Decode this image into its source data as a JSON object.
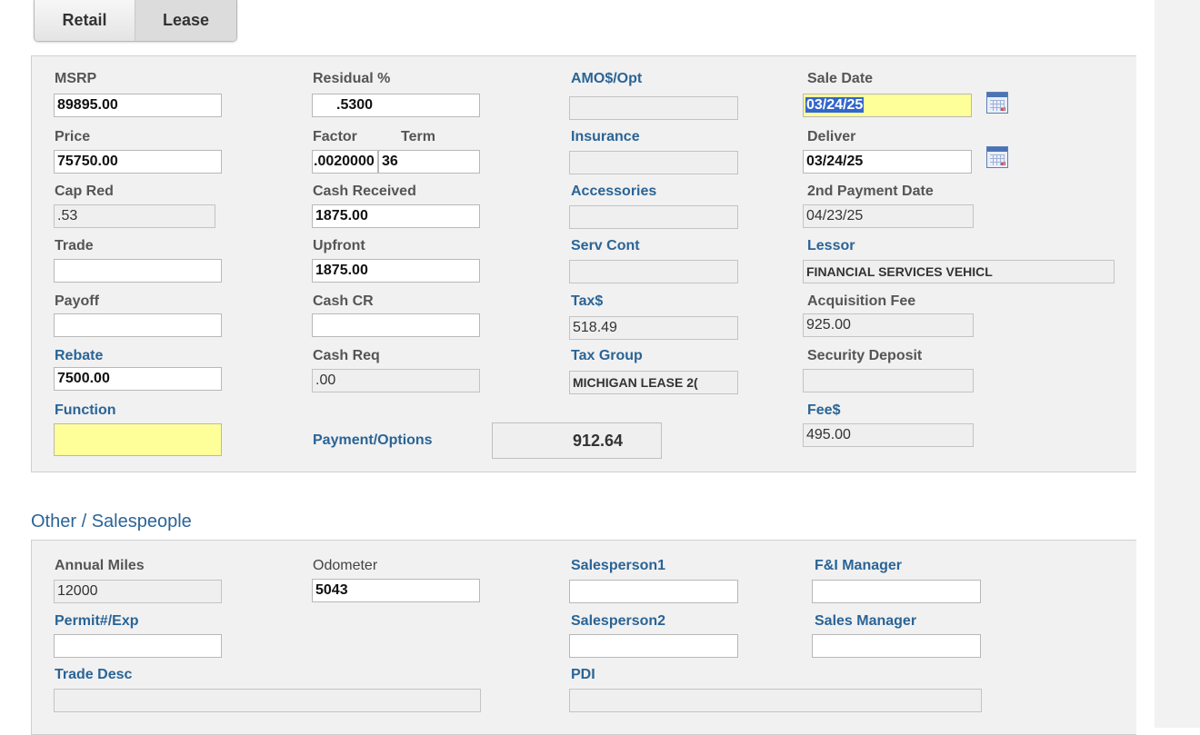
{
  "tabs": {
    "retail": "Retail",
    "lease": "Lease"
  },
  "col1": {
    "msrp_label": "MSRP",
    "msrp": "89895.00",
    "price_label": "Price",
    "price": "75750.00",
    "cap_red_label": "Cap Red",
    "cap_red": ".53",
    "trade_label": "Trade",
    "trade": "",
    "payoff_label": "Payoff",
    "payoff": "",
    "rebate_label": "Rebate",
    "rebate": "7500.00",
    "function_label": "Function",
    "function": ""
  },
  "col2": {
    "residual_label": "Residual %",
    "residual": ".5300",
    "factor_label": "Factor",
    "factor": ".0020000",
    "term_label": "Term",
    "term": "36",
    "cash_received_label": "Cash Received",
    "cash_received": "1875.00",
    "upfront_label": "Upfront",
    "upfront": "1875.00",
    "cash_cr_label": "Cash CR",
    "cash_cr": "",
    "cash_req_label": "Cash Req",
    "cash_req": ".00",
    "payment_options_label": "Payment/Options",
    "payment": "912.64"
  },
  "col3": {
    "amo_label": "AMO$/Opt",
    "amo": "",
    "insurance_label": "Insurance",
    "insurance": "",
    "accessories_label": "Accessories",
    "accessories": "",
    "serv_cont_label": "Serv Cont",
    "serv_cont": "",
    "tax_label": "Tax$",
    "tax": "518.49",
    "tax_group_label": "Tax Group",
    "tax_group": "MICHIGAN LEASE 2("
  },
  "col4": {
    "sale_date_label": "Sale Date",
    "sale_date": "03/24/25",
    "deliver_label": "Deliver",
    "deliver": "03/24/25",
    "second_payment_label": "2nd Payment Date",
    "second_payment": "04/23/25",
    "lessor_label": "Lessor",
    "lessor": "FINANCIAL SERVICES VEHICL",
    "acquisition_fee_label": "Acquisition Fee",
    "acquisition_fee": "925.00",
    "security_deposit_label": "Security Deposit",
    "security_deposit": "",
    "fee_label": "Fee$",
    "fee": "495.00"
  },
  "other": {
    "title": "Other / Salespeople",
    "annual_miles_label": "Annual Miles",
    "annual_miles": "12000",
    "odometer_label": "Odometer",
    "odometer": "5043",
    "salesperson1_label": "Salesperson1",
    "salesperson1": "",
    "fi_manager_label": "F&I Manager",
    "fi_manager": "",
    "permit_label": "Permit#/Exp",
    "permit": "",
    "salesperson2_label": "Salesperson2",
    "salesperson2": "",
    "sales_manager_label": "Sales Manager",
    "sales_manager": "",
    "trade_desc_label": "Trade Desc",
    "trade_desc": "",
    "pdi_label": "PDI",
    "pdi": ""
  },
  "colors": {
    "accent": "#2a6496",
    "highlight": "#ffff99",
    "selection": "#3366cc"
  },
  "icons": {
    "calendar": "calendar-icon"
  }
}
